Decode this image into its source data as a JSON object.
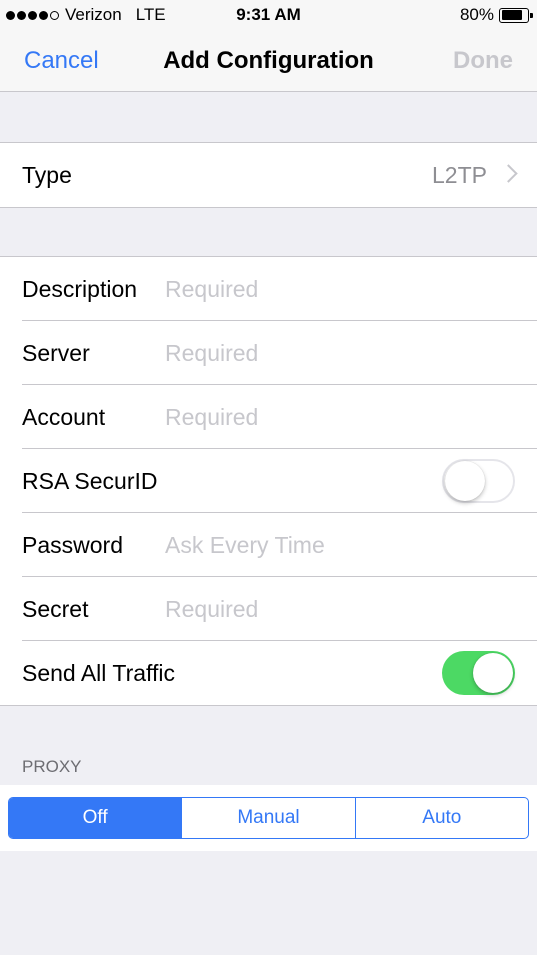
{
  "status_bar": {
    "carrier": "Verizon",
    "network": "LTE",
    "time": "9:31 AM",
    "battery_percent": "80%",
    "battery_level": 0.8,
    "signal_bars": 4
  },
  "nav": {
    "cancel_label": "Cancel",
    "title": "Add Configuration",
    "done_label": "Done"
  },
  "type_row": {
    "label": "Type",
    "value": "L2TP"
  },
  "fields": {
    "description": {
      "label": "Description",
      "placeholder": "Required"
    },
    "server": {
      "label": "Server",
      "placeholder": "Required"
    },
    "account": {
      "label": "Account",
      "placeholder": "Required"
    },
    "rsa_securid": {
      "label": "RSA SecurID",
      "on": false
    },
    "password": {
      "label": "Password",
      "placeholder": "Ask Every Time"
    },
    "secret": {
      "label": "Secret",
      "placeholder": "Required"
    },
    "send_all_traffic": {
      "label": "Send All Traffic",
      "on": true
    }
  },
  "proxy": {
    "header": "PROXY",
    "options": [
      "Off",
      "Manual",
      "Auto"
    ],
    "selected": "Off"
  },
  "colors": {
    "accent": "#3478f6",
    "switch_on": "#4cd964",
    "placeholder": "#c7c7cc",
    "background": "#efeff4"
  }
}
